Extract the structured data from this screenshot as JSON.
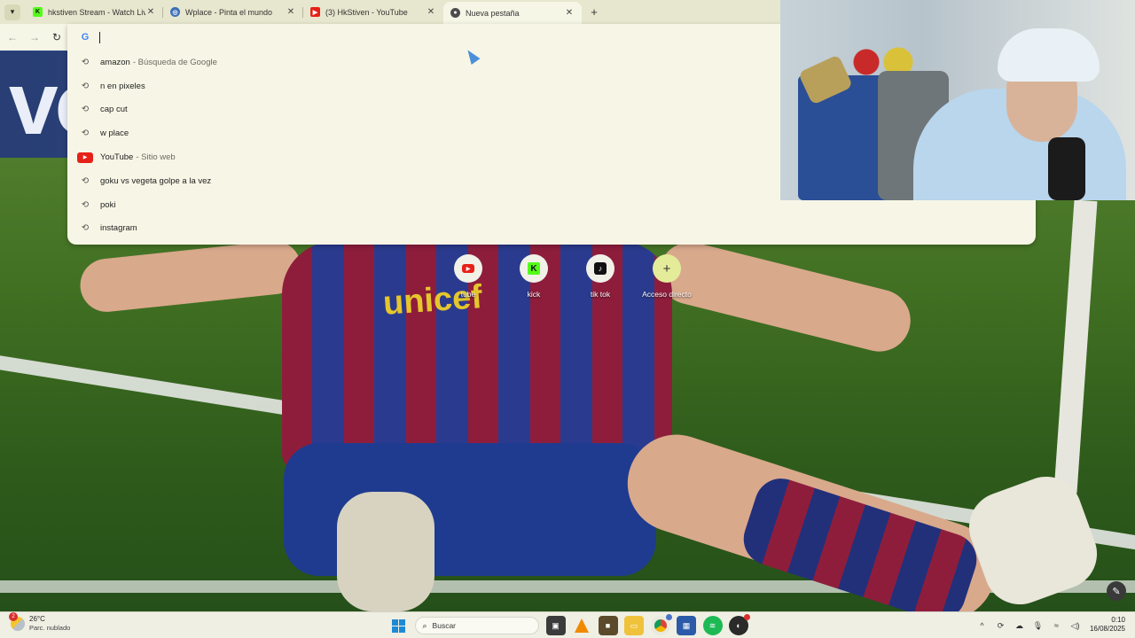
{
  "browser": {
    "tabs": [
      {
        "title": "hkstiven Stream - Watch Live o",
        "favicon": "kick-icon",
        "active": false
      },
      {
        "title": "Wplace - Pinta el mundo",
        "favicon": "globe-icon",
        "active": false
      },
      {
        "title": "(3) HkStiven - YouTube",
        "favicon": "youtube-icon",
        "active": false
      },
      {
        "title": "Nueva pestaña",
        "favicon": "chrome-icon",
        "active": true
      }
    ],
    "omnibox_value": "",
    "suggestions": [
      {
        "text": "amazon",
        "desc": "- Búsqueda de Google",
        "icon": "history-icon"
      },
      {
        "text": "n en pixeles",
        "desc": "",
        "icon": "history-icon"
      },
      {
        "text": "cap cut",
        "desc": "",
        "icon": "history-icon"
      },
      {
        "text": "w place",
        "desc": "",
        "icon": "history-icon"
      },
      {
        "text": "YouTube",
        "desc": "- Sitio web",
        "icon": "youtube-icon"
      },
      {
        "text": "goku vs vegeta golpe a la vez",
        "desc": "",
        "icon": "history-icon"
      },
      {
        "text": "poki",
        "desc": "",
        "icon": "history-icon"
      },
      {
        "text": "instagram",
        "desc": "",
        "icon": "history-icon"
      }
    ]
  },
  "wallpaper": {
    "banner_text": "vo",
    "sponsor_text": "unicef"
  },
  "shortcuts": [
    {
      "label": "tube",
      "icon": "youtube-icon"
    },
    {
      "label": "kick",
      "icon": "kick-icon"
    },
    {
      "label": "tik tok",
      "icon": "tiktok-icon"
    },
    {
      "label": "Acceso directo",
      "icon": "plus-icon"
    }
  ],
  "taskbar": {
    "weather": {
      "badge": "2",
      "temp": "26°C",
      "condition": "Parc. nublado"
    },
    "search_placeholder": "Buscar",
    "time": "0:10",
    "date": "16/08/2025"
  },
  "colors": {
    "tab_strip": "#e7e7cf",
    "omnibox_bg": "#f7f6e6",
    "youtube_red": "#e62117",
    "kick_green": "#53fc18",
    "taskbar_bg": "#efefe4"
  }
}
